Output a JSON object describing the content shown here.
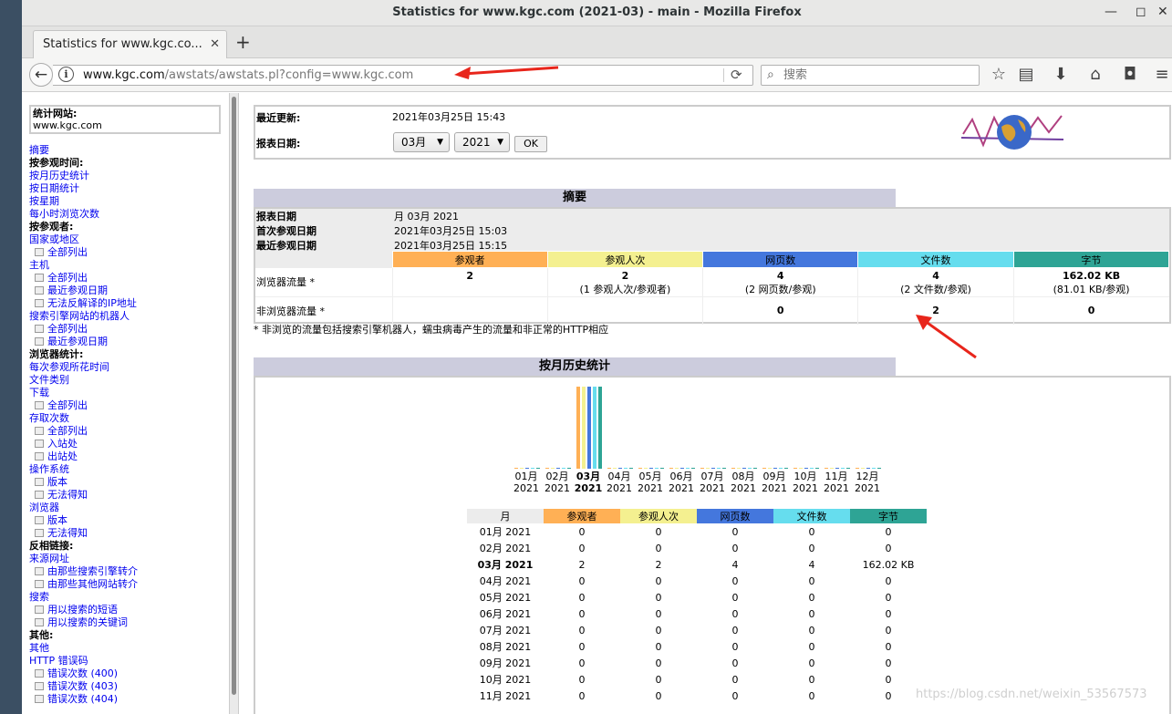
{
  "window": {
    "title": "Statistics for www.kgc.com (2021-03) - main - Mozilla Firefox"
  },
  "tab": {
    "label": "Statistics for www.kgc.co...",
    "close": "✕",
    "new_tab": "+"
  },
  "navbar": {
    "url_host": "www.kgc.com",
    "url_path": "/awstats/awstats.pl?config=www.kgc.com",
    "search_placeholder": "搜索"
  },
  "menu": {
    "site_label": "统计网站:",
    "site_value": "www.kgc.com",
    "items": [
      {
        "label": "摘要",
        "type": "link"
      },
      {
        "label": "按参观时间:",
        "type": "head"
      },
      {
        "label": "按月历史统计",
        "type": "link"
      },
      {
        "label": "按日期统计",
        "type": "link"
      },
      {
        "label": "按星期",
        "type": "link"
      },
      {
        "label": "每小时浏览次数",
        "type": "link"
      },
      {
        "label": "按参观者:",
        "type": "head"
      },
      {
        "label": "国家或地区",
        "type": "link"
      },
      {
        "label": "全部列出",
        "type": "sub"
      },
      {
        "label": "主机",
        "type": "link"
      },
      {
        "label": "全部列出",
        "type": "sub"
      },
      {
        "label": "最近参观日期",
        "type": "sub"
      },
      {
        "label": "无法反解译的IP地址",
        "type": "sub"
      },
      {
        "label": "搜索引擎网站的机器人",
        "type": "link"
      },
      {
        "label": "全部列出",
        "type": "sub"
      },
      {
        "label": "最近参观日期",
        "type": "sub"
      },
      {
        "label": "浏览器统计:",
        "type": "head"
      },
      {
        "label": "每次参观所花时间",
        "type": "link"
      },
      {
        "label": "文件类别",
        "type": "link"
      },
      {
        "label": "下载",
        "type": "link"
      },
      {
        "label": "全部列出",
        "type": "sub"
      },
      {
        "label": "存取次数",
        "type": "link"
      },
      {
        "label": "全部列出",
        "type": "sub"
      },
      {
        "label": "入站处",
        "type": "sub"
      },
      {
        "label": "出站处",
        "type": "sub"
      },
      {
        "label": "操作系统",
        "type": "link"
      },
      {
        "label": "版本",
        "type": "sub"
      },
      {
        "label": "无法得知",
        "type": "sub"
      },
      {
        "label": "浏览器",
        "type": "link"
      },
      {
        "label": "版本",
        "type": "sub"
      },
      {
        "label": "无法得知",
        "type": "sub"
      },
      {
        "label": "反相链接:",
        "type": "head"
      },
      {
        "label": "来源网址",
        "type": "link"
      },
      {
        "label": "由那些搜索引擎转介",
        "type": "sub"
      },
      {
        "label": "由那些其他网站转介",
        "type": "sub"
      },
      {
        "label": "搜索",
        "type": "link"
      },
      {
        "label": "用以搜索的短语",
        "type": "sub"
      },
      {
        "label": "用以搜索的关键词",
        "type": "sub"
      },
      {
        "label": "其他:",
        "type": "head"
      },
      {
        "label": "其他",
        "type": "link"
      },
      {
        "label": "HTTP 错误码",
        "type": "link"
      },
      {
        "label": "错误次数 (400)",
        "type": "sub"
      },
      {
        "label": "错误次数 (403)",
        "type": "sub"
      },
      {
        "label": "错误次数 (404)",
        "type": "sub"
      }
    ]
  },
  "header": {
    "last_update_label": "最近更新:",
    "last_update_value": "2021年03月25日 15:43",
    "report_date_label": "报表日期:",
    "month_select": "03月",
    "year_select": "2021",
    "ok_label": "OK"
  },
  "summary": {
    "title": "摘要",
    "rows": [
      {
        "label": "报表日期",
        "value": "月 03月 2021"
      },
      {
        "label": "首次参观日期",
        "value": "2021年03月25日 15:03"
      },
      {
        "label": "最近参观日期",
        "value": "2021年03月25日 15:15"
      }
    ],
    "columns": [
      "参观者",
      "参观人次",
      "网页数",
      "文件数",
      "字节"
    ],
    "browser_traffic": {
      "label": "浏览器流量 *",
      "values": [
        "2",
        "2",
        "4",
        "4",
        "162.02 KB"
      ],
      "notes": [
        "",
        "(1 参观人次/参观者)",
        "(2 网页数/参观)",
        "(2 文件数/参观)",
        "(81.01 KB/参观)"
      ]
    },
    "non_browser_traffic": {
      "label": "非浏览器流量 *",
      "values": [
        "",
        "",
        "0",
        "2",
        "0"
      ]
    },
    "footnote": "* 非浏览的流量包括搜索引擎机器人，蠕虫病毒产生的流量和非正常的HTTP相应"
  },
  "monthly": {
    "title": "按月历史统计",
    "columns": [
      "月",
      "参观者",
      "参观人次",
      "网页数",
      "文件数",
      "字节"
    ],
    "rows": [
      [
        "01月 2021",
        "0",
        "0",
        "0",
        "0",
        "0"
      ],
      [
        "02月 2021",
        "0",
        "0",
        "0",
        "0",
        "0"
      ],
      [
        "03月 2021",
        "2",
        "2",
        "4",
        "4",
        "162.02 KB"
      ],
      [
        "04月 2021",
        "0",
        "0",
        "0",
        "0",
        "0"
      ],
      [
        "05月 2021",
        "0",
        "0",
        "0",
        "0",
        "0"
      ],
      [
        "06月 2021",
        "0",
        "0",
        "0",
        "0",
        "0"
      ],
      [
        "07月 2021",
        "0",
        "0",
        "0",
        "0",
        "0"
      ],
      [
        "08月 2021",
        "0",
        "0",
        "0",
        "0",
        "0"
      ],
      [
        "09月 2021",
        "0",
        "0",
        "0",
        "0",
        "0"
      ],
      [
        "10月 2021",
        "0",
        "0",
        "0",
        "0",
        "0"
      ],
      [
        "11月 2021",
        "0",
        "0",
        "0",
        "0",
        "0"
      ]
    ],
    "current_month_index": 2
  },
  "chart_data": {
    "type": "bar",
    "categories": [
      "01月 2021",
      "02月 2021",
      "03月 2021",
      "04月 2021",
      "05月 2021",
      "06月 2021",
      "07月 2021",
      "08月 2021",
      "09月 2021",
      "10月 2021",
      "11月 2021",
      "12月 2021"
    ],
    "month_labels": [
      "01月",
      "02月",
      "03月",
      "04月",
      "05月",
      "06月",
      "07月",
      "08月",
      "09月",
      "10月",
      "11月",
      "12月"
    ],
    "year_label": "2021",
    "highlight_index": 2,
    "series": [
      {
        "name": "参观者",
        "color": "#ffb055",
        "values": [
          0,
          0,
          2,
          0,
          0,
          0,
          0,
          0,
          0,
          0,
          0,
          0
        ]
      },
      {
        "name": "参观人次",
        "color": "#f4f090",
        "values": [
          0,
          0,
          2,
          0,
          0,
          0,
          0,
          0,
          0,
          0,
          0,
          0
        ]
      },
      {
        "name": "网页数",
        "color": "#4477dd",
        "values": [
          0,
          0,
          4,
          0,
          0,
          0,
          0,
          0,
          0,
          0,
          0,
          0
        ]
      },
      {
        "name": "文件数",
        "color": "#66ddee",
        "values": [
          0,
          0,
          4,
          0,
          0,
          0,
          0,
          0,
          0,
          0,
          0,
          0
        ]
      },
      {
        "name": "字节",
        "color": "#2ea495",
        "values": [
          0,
          0,
          162.02,
          0,
          0,
          0,
          0,
          0,
          0,
          0,
          0,
          0
        ]
      }
    ]
  },
  "colors": {
    "visitors": "#ffb055",
    "visits": "#f4f090",
    "pages": "#4477dd",
    "hits": "#66ddee",
    "bytes": "#2ea495",
    "section": "#ccccdd"
  },
  "watermark": "https://blog.csdn.net/weixin_53567573"
}
